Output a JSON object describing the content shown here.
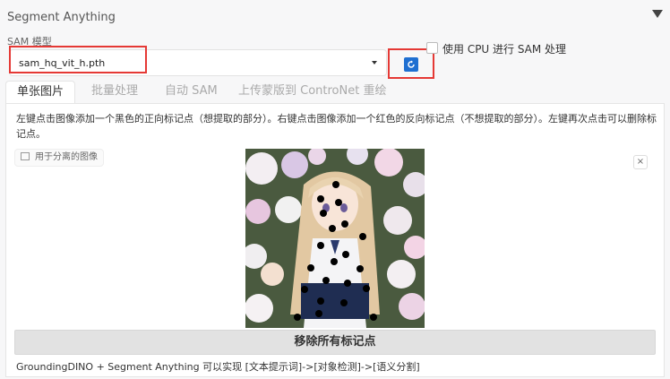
{
  "panel": {
    "title": "Segment Anything",
    "collapse_icon": "triangle-down-icon"
  },
  "sam": {
    "label": "SAM 模型",
    "selected_model": "sam_hq_vit_h.pth",
    "refresh_icon": "refresh-icon",
    "cpu_label": "使用 CPU 进行 SAM 处理",
    "cpu_checked": false
  },
  "tabs": [
    {
      "label": "单张图片",
      "active": true
    },
    {
      "label": "批量处理",
      "active": false
    },
    {
      "label": "自动 SAM",
      "active": false
    },
    {
      "label": "上传蒙版到 ControNet 重绘",
      "active": false
    }
  ],
  "single": {
    "instruction": "左键点击图像添加一个黑色的正向标记点（想提取的部分）。右键点击图像添加一个红色的反向标记点（不想提取的部分）。左键再次点击可以删除标记点。",
    "image_label": "用于分离的图像",
    "close_symbol": "×",
    "remove_button": "移除所有标记点"
  },
  "footer": {
    "text": "GroundingDINO + Segment Anything 可以实现 [文本提示词]->[对象检测]->[语义分割]"
  },
  "colors": {
    "highlight": "#e53935",
    "accent": "#1f6fd1",
    "marker": "#000000"
  }
}
